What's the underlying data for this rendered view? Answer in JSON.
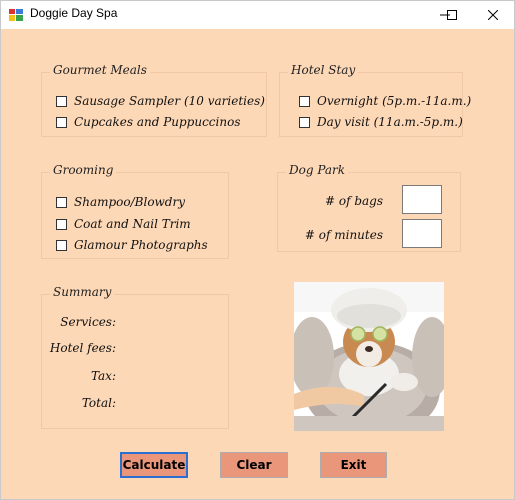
{
  "window": {
    "title": "Doggie Day Spa",
    "controls": [
      "minimize-icon",
      "maximize-icon",
      "close-icon"
    ]
  },
  "gourmet_meals": {
    "legend": "Gourmet Meals",
    "items": [
      {
        "label": "Sausage Sampler (10 varieties)",
        "checked": false
      },
      {
        "label": "Cupcakes and Puppuccinos",
        "checked": false
      }
    ]
  },
  "hotel_stay": {
    "legend": "Hotel Stay",
    "items": [
      {
        "label": "Overnight (5p.m.-11a.m.)",
        "checked": false
      },
      {
        "label": "Day visit (11a.m.-5p.m.)",
        "checked": false
      }
    ]
  },
  "grooming": {
    "legend": "Grooming",
    "items": [
      {
        "label": "Shampoo/Blowdry",
        "checked": false
      },
      {
        "label": "Coat and Nail Trim",
        "checked": false
      },
      {
        "label": "Glamour Photographs",
        "checked": false
      }
    ]
  },
  "dog_park": {
    "legend": "Dog Park",
    "bags_label": "# of bags",
    "bags_value": "",
    "minutes_label": "# of minutes",
    "minutes_value": ""
  },
  "summary": {
    "legend": "Summary",
    "services_label": "Services:",
    "hotel_fees_label": "Hotel fees:",
    "tax_label": "Tax:",
    "total_label": "Total:"
  },
  "buttons": {
    "calculate": "Calculate",
    "clear": "Clear",
    "exit": "Exit"
  },
  "colors": {
    "form_background": "#fdd8b6",
    "button_background": "#e9967a",
    "default_button_border": "#2b6fd4"
  }
}
